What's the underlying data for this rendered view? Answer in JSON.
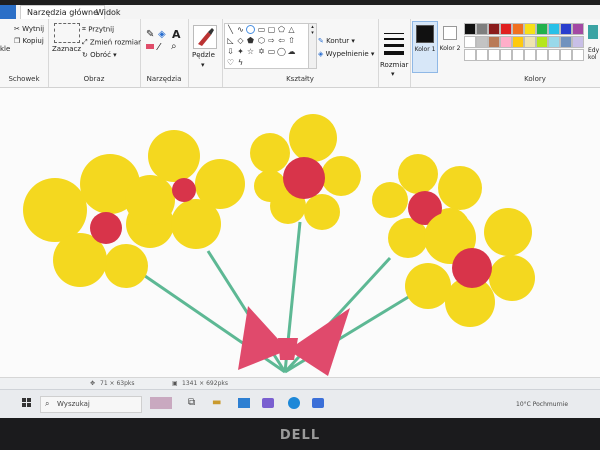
{
  "tabs": {
    "file": "",
    "home": "Narzędzia główne",
    "view": "Widok"
  },
  "clipboard": {
    "paste": "kle",
    "cut": "Wytnij",
    "copy": "Kopiuj",
    "label": "Schowek"
  },
  "image": {
    "select": "Zaznacz",
    "crop": "Przytnij",
    "resize": "Zmień rozmiar",
    "rotate": "Obróć",
    "label": "Obraz"
  },
  "tools": {
    "label": "Narzędzia",
    "text_glyph": "A"
  },
  "brushes": {
    "label": "Pędzle"
  },
  "shapes": {
    "outline": "Kontur",
    "fill": "Wypełnienie",
    "label": "Kształty"
  },
  "size": {
    "label": "Rozmiar"
  },
  "colors": {
    "color1": "Kolor 1",
    "color2": "Kolor 2",
    "label": "Kolory",
    "edit": "Edy",
    "edit2": "kol",
    "palette_row1": [
      "#111111",
      "#7f7f7f",
      "#8a1c1c",
      "#e02020",
      "#f07020",
      "#f7e017",
      "#23b14c",
      "#28c0e8",
      "#2a3fce",
      "#a349a4"
    ],
    "palette_row2": [
      "#ffffff",
      "#c3c3c3",
      "#b97a57",
      "#ffaec9",
      "#ffc90e",
      "#efe4b0",
      "#b5e61d",
      "#99d9ea",
      "#7092be",
      "#c8bfe7"
    ],
    "primary": "#111111",
    "secondary": "#ffffff"
  },
  "status": {
    "cursor": "71 × 63pks",
    "canvas_size": "1341 × 692pks"
  },
  "taskbar": {
    "search": "Wyszukaj",
    "weather": "10°C Pochmurnie"
  },
  "bezel": {
    "brand": "DELL"
  }
}
